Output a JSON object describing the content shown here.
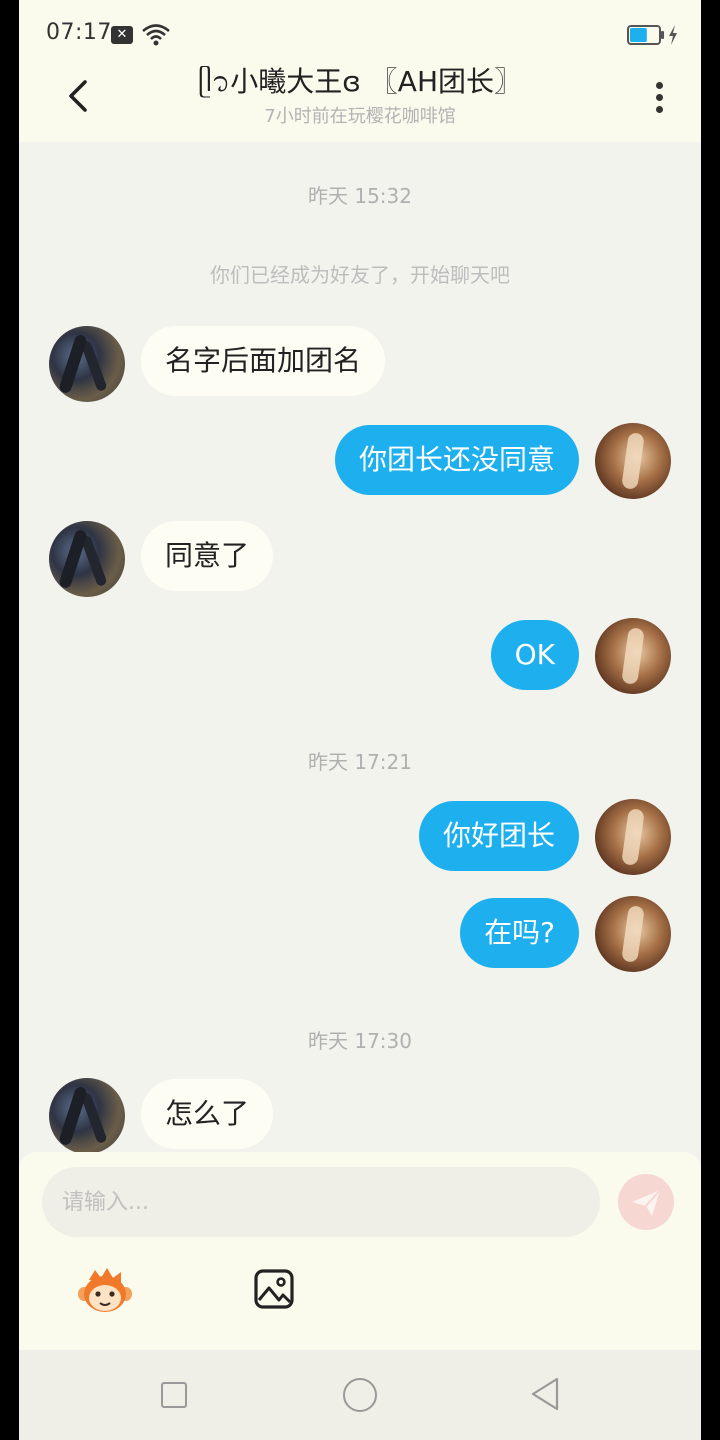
{
  "status": {
    "time": "07:17",
    "notif_icon": "x-box-icon",
    "battery_percent": 60
  },
  "header": {
    "title": "ᥫ᭡小曦大王ɞ 〖AH团长〗",
    "subtitle": "7小时前在玩樱花咖啡馆"
  },
  "chat": {
    "timestamps": [
      "昨天 15:32",
      "昨天 17:21",
      "昨天 17:30"
    ],
    "system_message": "你们已经成为好友了，开始聊天吧",
    "messages": [
      {
        "side": "left",
        "text": "名字后面加团名"
      },
      {
        "side": "right",
        "text": "你团长还没同意"
      },
      {
        "side": "left",
        "text": "同意了"
      },
      {
        "side": "right",
        "text": "OK"
      },
      {
        "side": "right",
        "text": "你好团长"
      },
      {
        "side": "right",
        "text": "在吗?"
      },
      {
        "side": "left",
        "text": "怎么了"
      }
    ]
  },
  "input": {
    "placeholder": "请输入..."
  },
  "colors": {
    "accent": "#1eb0ee",
    "background": "#f3f3ee",
    "bar": "#fafaed",
    "send_disabled": "#f6d7d2"
  }
}
